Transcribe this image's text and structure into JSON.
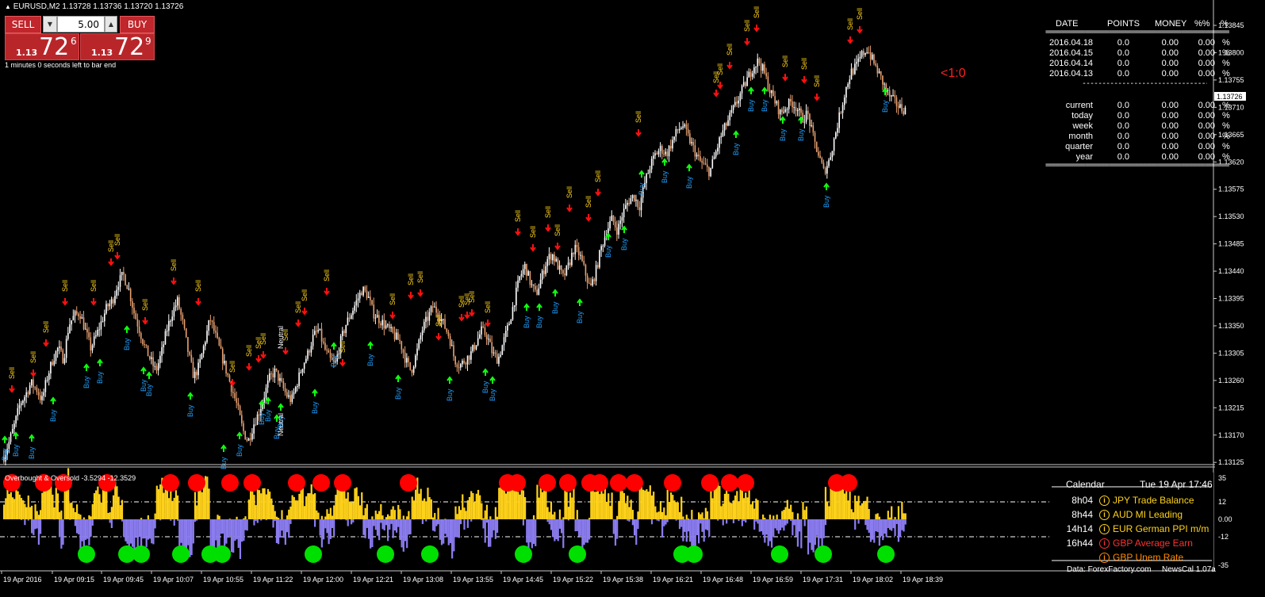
{
  "window": {
    "symbol_header": "EURUSD,M2  1.13728 1.13736 1.13720 1.13726"
  },
  "trade_panel": {
    "sell_label": "SELL",
    "buy_label": "BUY",
    "lot_value": "5.00",
    "sell_price_prefix": "1.13",
    "sell_price_main": "72",
    "sell_price_sup": "6",
    "buy_price_prefix": "1.13",
    "buy_price_main": "72",
    "buy_price_sup": "9",
    "countdown": "1 minutes 0 seconds left to bar end",
    "colors": {
      "button": "#c0262b"
    }
  },
  "ratio_label": "<1:0",
  "stats": {
    "headers": [
      "DATE",
      "POINTS",
      "MONEY",
      "%%",
      "%"
    ],
    "rows": [
      {
        "label": "2016.04.18",
        "points": "0.0",
        "money": "0.00",
        "pct": "0.00",
        "unit": "%"
      },
      {
        "label": "2016.04.15",
        "points": "0.0",
        "money": "0.00",
        "pct": "0.00",
        "unit": "%"
      },
      {
        "label": "2016.04.14",
        "points": "0.0",
        "money": "0.00",
        "pct": "0.00",
        "unit": "%"
      },
      {
        "label": "2016.04.13",
        "points": "0.0",
        "money": "0.00",
        "pct": "0.00",
        "unit": "%"
      }
    ],
    "periods": [
      {
        "label": "current",
        "points": "0.0",
        "money": "0.00",
        "pct": "0.00",
        "unit": "%"
      },
      {
        "label": "today",
        "points": "0.0",
        "money": "0.00",
        "pct": "0.00",
        "unit": "%"
      },
      {
        "label": "week",
        "points": "0.0",
        "money": "0.00",
        "pct": "0.00",
        "unit": "%"
      },
      {
        "label": "month",
        "points": "0.0",
        "money": "0.00",
        "pct": "0.00",
        "unit": "%"
      },
      {
        "label": "quarter",
        "points": "0.0",
        "money": "0.00",
        "pct": "0.00",
        "unit": "%"
      },
      {
        "label": "year",
        "points": "0.0",
        "money": "0.00",
        "pct": "0.00",
        "unit": "%"
      }
    ],
    "double_rule": "=========================================================================",
    "single_rule": "-----------------------------------------------------------------"
  },
  "price_axis": {
    "labels": [
      "1.13845",
      "1.13800",
      "1.13755",
      "1.13710",
      "1.13665",
      "1.13620",
      "1.13575",
      "1.13530",
      "1.13485",
      "1.13440",
      "1.13395",
      "1.13350",
      "1.13305",
      "1.13260",
      "1.13215",
      "1.13170",
      "1.13125"
    ],
    "current_price": "1.13726"
  },
  "indicator": {
    "title": "Overbought & Oversold -3.5294 -12.3529",
    "levels": [
      "35",
      "12",
      "0.00",
      "-12",
      "-35"
    ],
    "colors": {
      "positive": "#ffd21a",
      "negative": "#8b7cf0",
      "overbought": "#ff0000",
      "oversold": "#00e000"
    }
  },
  "time_axis": {
    "labels": [
      "19 Apr 2016",
      "19 Apr 09:15",
      "19 Apr 09:45",
      "19 Apr 10:07",
      "19 Apr 10:55",
      "19 Apr 11:22",
      "19 Apr 12:00",
      "19 Apr 12:21",
      "19 Apr 13:08",
      "19 Apr 13:55",
      "19 Apr 14:45",
      "19 Apr 15:22",
      "19 Apr 15:38",
      "19 Apr 16:21",
      "19 Apr 16:48",
      "19 Apr 16:59",
      "19 Apr 17:31",
      "19 Apr 18:02",
      "19 Apr 18:39"
    ]
  },
  "calendar": {
    "title": "Calendar",
    "datetime": "Tue 19 Apr 17:46",
    "events": [
      {
        "time": "8h04",
        "icon": "info-icon",
        "text": "JPY  Trade Balance",
        "color": "#ffd21a"
      },
      {
        "time": "8h44",
        "icon": "info-icon",
        "text": "AUD MI Leading",
        "color": "#ffd21a"
      },
      {
        "time": "14h14",
        "icon": "info-icon",
        "text": "EUR German PPI m/m",
        "color": "#ffd21a"
      },
      {
        "time": "16h44",
        "icon": "info-icon",
        "text": "GBP Average Earn",
        "color": "#ff3030"
      },
      {
        "time": "",
        "icon": "info-icon",
        "text": "GBP Unem Rate",
        "color": "#ff8a00"
      }
    ],
    "footer_left": "Data: ForexFactory.com",
    "footer_right": "NewsCal 1.07a"
  },
  "signals": {
    "sell": "Sell",
    "buy": "Buy",
    "neutral": "Neutral"
  },
  "chart_data": {
    "type": "candlestick",
    "symbol": "EURUSD",
    "timeframe": "M2",
    "ylim": [
      1.13125,
      1.1387
    ],
    "close_path": [
      1.13135,
      1.1316,
      1.1319,
      1.13225,
      1.1324,
      1.1326,
      1.1325,
      1.1323,
      1.1327,
      1.133,
      1.1332,
      1.133,
      1.1336,
      1.13375,
      1.1338,
      1.1335,
      1.1332,
      1.1334,
      1.13365,
      1.1339,
      1.134,
      1.1343,
      1.13445,
      1.1342,
      1.1338,
      1.1335,
      1.1332,
      1.133,
      1.1328,
      1.1331,
      1.1335,
      1.1338,
      1.134,
      1.1336,
      1.1331,
      1.1327,
      1.1329,
      1.1333,
      1.1337,
      1.1334,
      1.1331,
      1.1328,
      1.1325,
      1.1322,
      1.1318,
      1.1316,
      1.1319,
      1.1321,
      1.1324,
      1.1327,
      1.1328,
      1.1326,
      1.1324,
      1.1323,
      1.1326,
      1.1329,
      1.1331,
      1.1334,
      1.1335,
      1.1332,
      1.133,
      1.1329,
      1.1333,
      1.1336,
      1.1338,
      1.134,
      1.1342,
      1.1341,
      1.1338,
      1.1337,
      1.1336,
      1.1335,
      1.1334,
      1.1333,
      1.133,
      1.1328,
      1.1331,
      1.1335,
      1.1337,
      1.1339,
      1.1338,
      1.1336,
      1.1334,
      1.133,
      1.1329,
      1.133,
      1.1331,
      1.1333,
      1.1335,
      1.1334,
      1.1331,
      1.133,
      1.1333,
      1.1336,
      1.134,
      1.1344,
      1.1346,
      1.1343,
      1.1341,
      1.1344,
      1.1347,
      1.1348,
      1.1346,
      1.1344,
      1.1346,
      1.1349,
      1.1348,
      1.1345,
      1.1342,
      1.1345,
      1.1349,
      1.1352,
      1.1354,
      1.1352,
      1.1355,
      1.1357,
      1.1358,
      1.1356,
      1.136,
      1.1363,
      1.1365,
      1.1366,
      1.1365,
      1.1367,
      1.1369,
      1.137,
      1.1368,
      1.1366,
      1.1364,
      1.1363,
      1.1362,
      1.1365,
      1.1368,
      1.137,
      1.1372,
      1.1374,
      1.1376,
      1.1378,
      1.138,
      1.1381,
      1.1379,
      1.1376,
      1.1374,
      1.1372,
      1.1373,
      1.1374,
      1.1373,
      1.1371,
      1.1372,
      1.1368,
      1.1365,
      1.1362,
      1.1364,
      1.1368,
      1.1372,
      1.1376,
      1.1379,
      1.138,
      1.1382,
      1.1383,
      1.1381,
      1.1379,
      1.1377,
      1.1375,
      1.1374,
      1.1373,
      1.13726
    ]
  }
}
